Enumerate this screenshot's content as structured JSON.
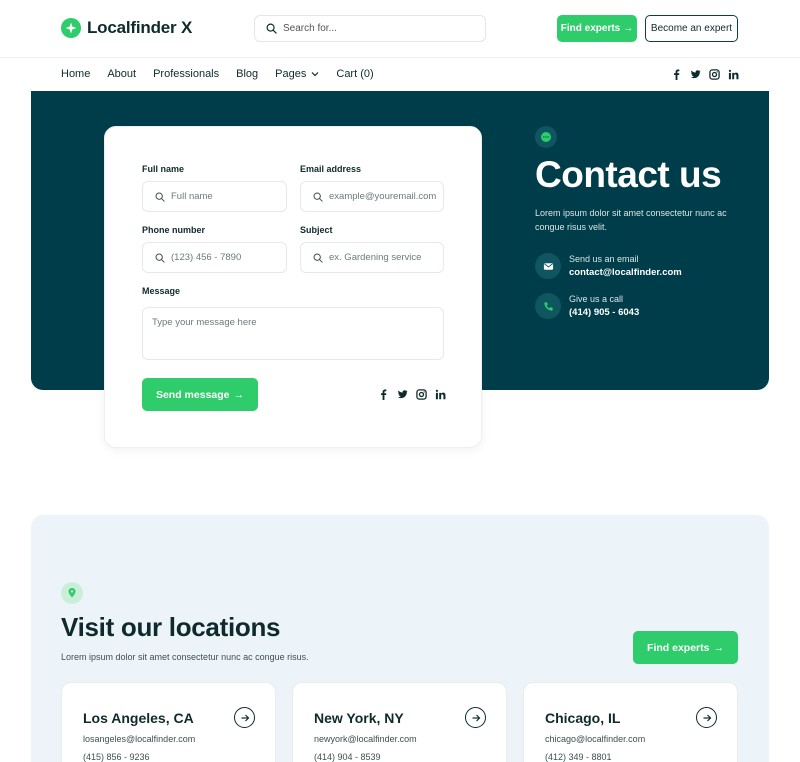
{
  "header": {
    "logo_text": "Localfinder X",
    "search_placeholder": "Search for...",
    "find_experts_label": "Find experts",
    "become_expert_label": "Become an expert"
  },
  "nav": {
    "items": [
      "Home",
      "About",
      "Professionals",
      "Blog",
      "Pages",
      "Cart (0)"
    ]
  },
  "social_icons": [
    "facebook-icon",
    "twitter-icon",
    "instagram-icon",
    "linkedin-icon"
  ],
  "form": {
    "full_name_label": "Full name",
    "full_name_placeholder": "Full name",
    "email_label": "Email address",
    "email_placeholder": "example@youremail.com",
    "phone_label": "Phone number",
    "phone_placeholder": "(123) 456 - 7890",
    "subject_label": "Subject",
    "subject_placeholder": "ex. Gardening service",
    "message_label": "Message",
    "message_placeholder": "Type your message here",
    "send_label": "Send message"
  },
  "contact": {
    "title": "Contact us",
    "description": "Lorem ipsum dolor sit amet consectetur nunc ac congue risus velit.",
    "email_label": "Send us an email",
    "email_value": "contact@localfinder.com",
    "call_label": "Give us a call",
    "call_value": "(414) 905 - 6043"
  },
  "locations": {
    "title": "Visit our locations",
    "description": "Lorem ipsum dolor sit amet consectetur nunc ac congue risus.",
    "find_experts_label": "Find experts",
    "cities": [
      {
        "name": "Los Angeles, CA",
        "email": "losangeles@localfinder.com",
        "phone": "(415) 856 - 9236"
      },
      {
        "name": "New York, NY",
        "email": "newyork@localfinder.com",
        "phone": "(414) 904 - 8539"
      },
      {
        "name": "Chicago, IL",
        "email": "chicago@localfinder.com",
        "phone": "(412) 349 - 8801"
      }
    ]
  },
  "colors": {
    "accent_green": "#2ecc6a",
    "hero_dark": "#003d4a",
    "locations_bg": "#edf4f9"
  }
}
